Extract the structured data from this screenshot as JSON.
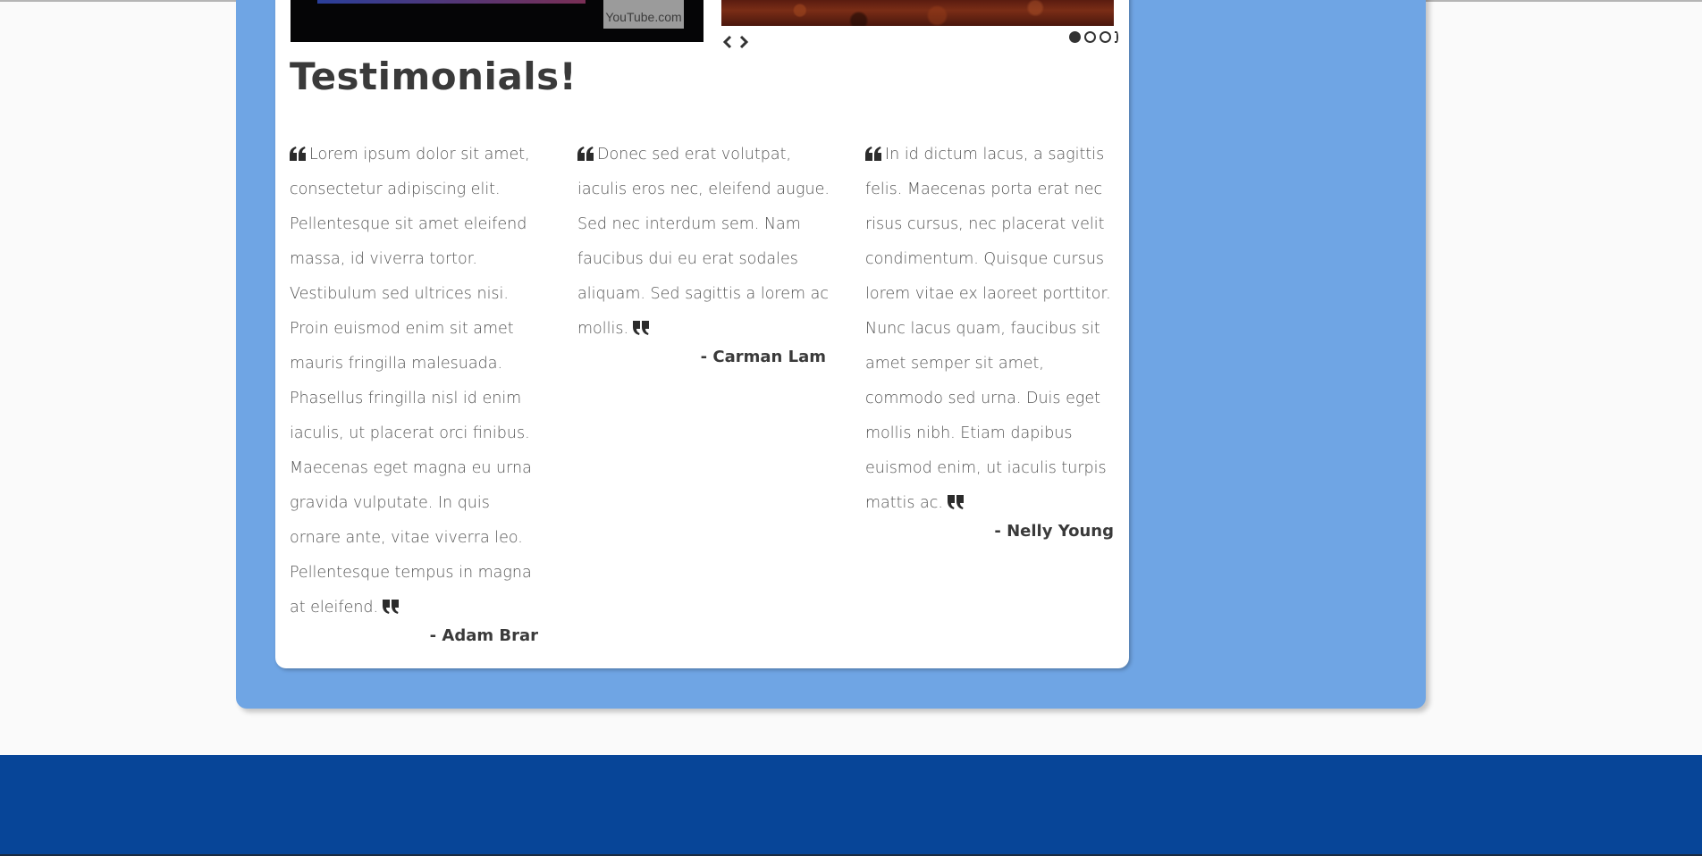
{
  "section": {
    "title": "Testimonials!"
  },
  "video": {
    "watermark": "YouTube.com"
  },
  "slider": {
    "prev_icon": "chevron-left-icon",
    "next_icon": "chevron-right-icon",
    "dots_total": 3,
    "active_dot": 1
  },
  "testimonials": [
    {
      "text": "Lorem ipsum dolor sit amet, consectetur adipiscing elit. Pellentesque sit amet eleifend massa, id viverra tortor. Vestibulum sed ultrices nisi. Proin euismod enim sit amet mauris fringilla malesuada. Phasellus fringilla nisl id enim iaculis, ut placerat orci finibus. Maecenas eget magna eu urna gravida vulputate. In quis ornare ante, vitae viverra leo. Pellentesque tempus in magna at eleifend.",
      "author": "- Adam Brar"
    },
    {
      "text": "Donec sed erat volutpat, iaculis eros nec, eleifend augue. Sed nec interdum sem. Nam faucibus dui eu erat sodales aliquam. Sed sagittis a lorem ac mollis.",
      "author": "- Carman Lam"
    },
    {
      "text": "In id dictum lacus, a sagittis felis. Maecenas porta erat nec risus cursus, nec placerat velit condimentum. Quisque cursus lorem vitae ex laoreet porttitor. Nunc lacus quam, faucibus sit amet semper sit amet, commodo sed urna. Duis eget mollis nibh. Etiam dapibus euismod enim, ut iaculis turpis mattis ac.",
      "author": "- Nelly Young"
    }
  ],
  "colors": {
    "panel_blue": "#6fa5e4",
    "footer_blue": "#074598",
    "card_white": "#ffffff",
    "text_dark": "#3a3a3a"
  }
}
